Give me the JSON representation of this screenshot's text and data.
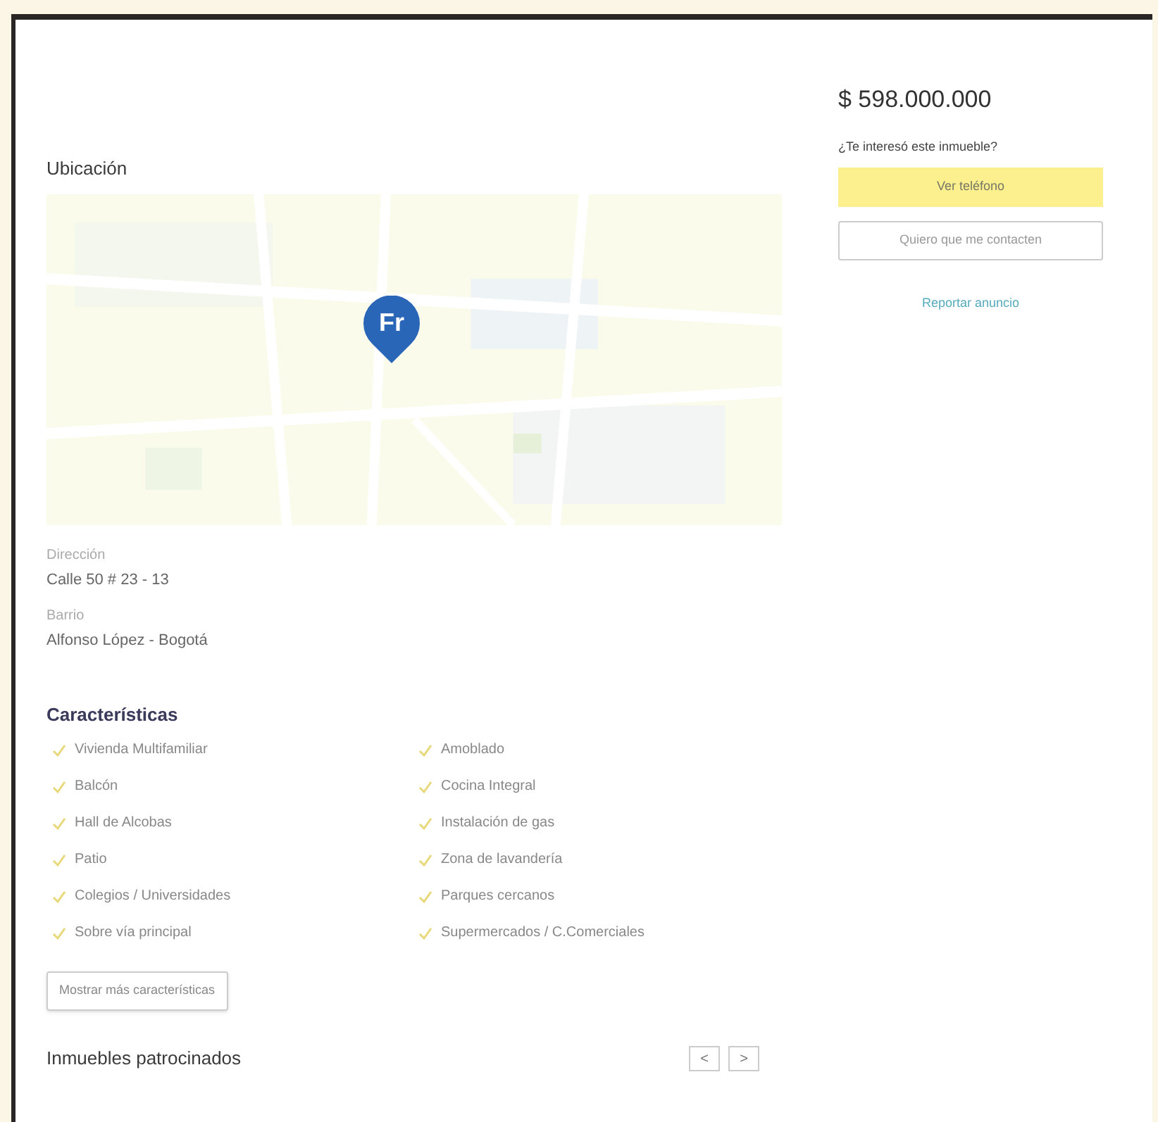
{
  "price": {
    "value": "$ 598.000.000"
  },
  "contact": {
    "question": "¿Te interesó este inmueble?",
    "primary_button": "Ver teléfono",
    "secondary_button": "Quiero que me contacten",
    "report_link": "Reportar anuncio"
  },
  "location": {
    "title": "Ubicación",
    "map": {
      "kind": "picture",
      "marker": "Fr"
    },
    "fields": [
      {
        "label": "Dirección",
        "value": "Calle 50 # 23 - 13"
      },
      {
        "label": "Barrio",
        "value": "Alfonso López - Bogotá"
      }
    ]
  },
  "features": {
    "title": "Características",
    "items": [
      {
        "label": "Vivienda Multifamiliar"
      },
      {
        "label": "Amoblado"
      },
      {
        "label": "Balcón"
      },
      {
        "label": "Cocina Integral"
      },
      {
        "label": "Hall de Alcobas"
      },
      {
        "label": "Instalación de gas"
      },
      {
        "label": "Patio"
      },
      {
        "label": "Zona de lavandería"
      },
      {
        "label": "Colegios / Universidades"
      },
      {
        "label": "Parques cercanos"
      },
      {
        "label": "Sobre vía principal"
      },
      {
        "label": "Supermercados / C.Comerciales"
      }
    ],
    "more_button": "Mostrar más características"
  },
  "sponsored": {
    "title": "Inmuebles patrocinados",
    "prev": "<",
    "next": ">"
  }
}
